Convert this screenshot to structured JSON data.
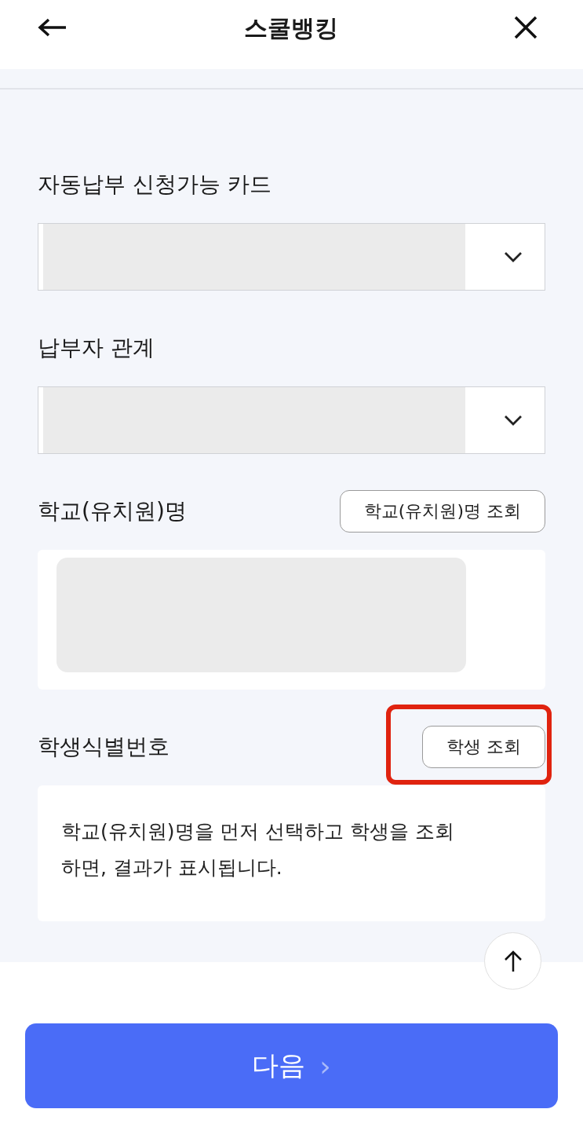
{
  "header": {
    "title": "스쿨뱅킹"
  },
  "sections": [
    {
      "label": "자동납부 신청가능 카드",
      "kind": "select",
      "redacted": true
    },
    {
      "label": "납부자 관계",
      "kind": "select",
      "redacted": true
    },
    {
      "label": "학교(유치원)명",
      "kind": "panel",
      "redacted": true,
      "button": {
        "label": "학교(유치원)명 조회",
        "highlighted": false
      }
    },
    {
      "label": "학생식별번호",
      "kind": "panel",
      "redacted": false,
      "message": "학교(유치원)명을 먼저 선택하고 학생을 조회하면, 결과가 표시됩니다.",
      "button": {
        "label": "학생 조회",
        "highlighted": true
      }
    }
  ],
  "next_button": {
    "label": "다음",
    "glyph": "›"
  }
}
